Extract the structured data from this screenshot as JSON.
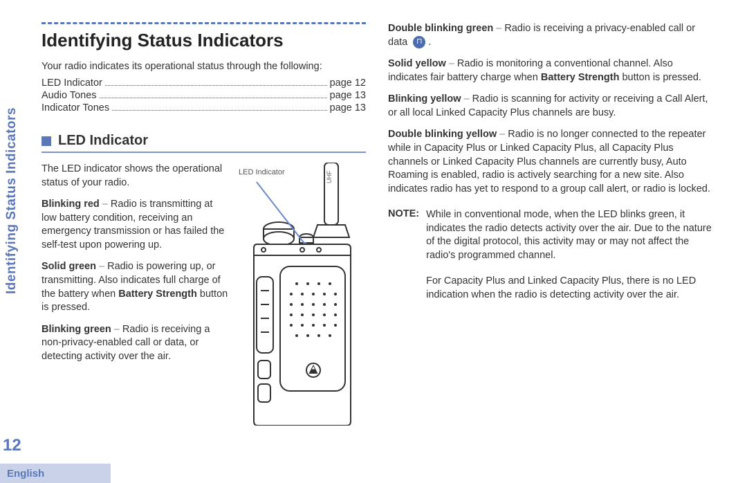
{
  "sidebar": {
    "vertical_title": "Identifying Status Indicators",
    "page_number": "12",
    "language": "English"
  },
  "chapter_title": "Identifying Status Indicators",
  "intro": "Your radio indicates its operational status through the following:",
  "toc": [
    {
      "label": "LED Indicator",
      "page": "page 12"
    },
    {
      "label": "Audio Tones",
      "page": "page 13"
    },
    {
      "label": "Indicator Tones",
      "page": "page 13"
    }
  ],
  "section": {
    "title": "LED Indicator",
    "intro": "The LED indicator shows the operational status of your radio.",
    "figure_label": "LED Indicator"
  },
  "led_states_left": [
    {
      "name": "Blinking red",
      "desc": "Radio is transmitting at low battery condition, receiving an emergency transmission or has failed the self-test upon powering up."
    },
    {
      "name": "Solid green",
      "desc_pre": "Radio is powering up, or transmitting. Also indicates full charge of the battery when ",
      "bold": "Battery Strength",
      "desc_post": " button is pressed."
    },
    {
      "name": "Blinking green",
      "desc": "Radio is receiving a non-privacy-enabled call or data, or detecting activity over the air."
    }
  ],
  "led_states_right": [
    {
      "name": "Double blinking green",
      "desc": "Radio is receiving a privacy-enabled call or data",
      "has_icon": true,
      "icon_glyph": "⊓"
    },
    {
      "name": "Solid yellow",
      "desc_pre": "Radio is monitoring a conventional channel. Also indicates fair battery charge when ",
      "bold": "Battery Strength",
      "desc_post": " button is pressed."
    },
    {
      "name": "Blinking yellow",
      "desc": "Radio is scanning for activity or receiving a Call Alert, or all local Linked Capacity Plus channels are busy."
    },
    {
      "name": "Double blinking yellow",
      "desc": "Radio is no longer connected to the repeater while in Capacity Plus or Linked Capacity Plus, all Capacity Plus channels or Linked Capacity Plus channels are currently busy, Auto Roaming is enabled, radio is actively searching for a new site. Also indicates radio has yet to respond to a group call alert, or radio is locked."
    }
  ],
  "note": {
    "label": "NOTE:",
    "p1": "While in conventional mode, when the LED blinks green, it indicates the radio detects activity over the air. Due to the nature of the digital protocol, this activity may or may not affect the radio's programmed channel.",
    "p2": "For Capacity Plus and Linked Capacity Plus, there is no LED indication when the radio is detecting activity over the air."
  },
  "dash": " – "
}
